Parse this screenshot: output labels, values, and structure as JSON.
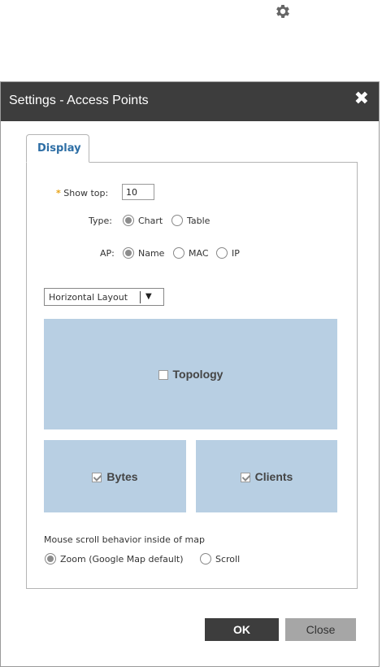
{
  "page": {
    "gear_icon": "gear-icon"
  },
  "dialog": {
    "title": "Settings - Access Points",
    "close_glyph": "✖",
    "tabs": [
      {
        "label": "Display",
        "active": true
      }
    ],
    "form": {
      "show_top": {
        "required_mark": "*",
        "label": "Show top:",
        "value": "10"
      },
      "type": {
        "label": "Type:",
        "options": [
          "Chart",
          "Table"
        ],
        "selected": "Chart"
      },
      "ap": {
        "label": "AP:",
        "options": [
          "Name",
          "MAC",
          "IP"
        ],
        "selected": "Name"
      },
      "layout": {
        "value": "Horizontal Layout",
        "arrow": "▼"
      },
      "widgets": [
        {
          "label": "Topology",
          "checked": false
        },
        {
          "label": "Bytes",
          "checked": true
        },
        {
          "label": "Clients",
          "checked": true
        }
      ],
      "scroll": {
        "label": "Mouse scroll behavior inside of map",
        "options": [
          "Zoom (Google Map default)",
          "Scroll"
        ],
        "selected": "Zoom (Google Map default)"
      }
    },
    "buttons": {
      "ok": "OK",
      "close": "Close"
    }
  },
  "colors": {
    "titlebar": "#3d3d3d",
    "widget_zone": "#b8cfe3",
    "tab_text": "#2d6ea5",
    "required": "#e8a317"
  }
}
